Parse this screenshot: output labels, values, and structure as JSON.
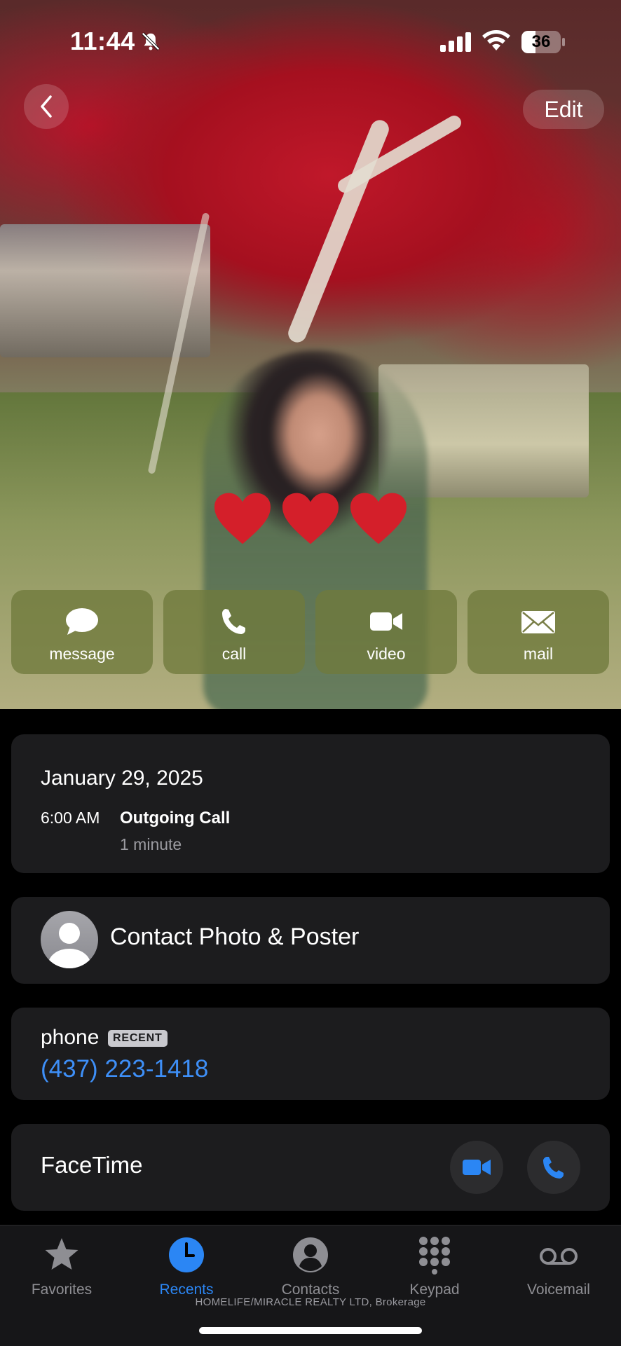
{
  "status_bar": {
    "time": "11:44",
    "battery": "36",
    "battery_level": 0.36
  },
  "nav": {
    "edit_label": "Edit"
  },
  "actions": [
    {
      "label": "message",
      "icon": "message-bubble-icon"
    },
    {
      "label": "call",
      "icon": "phone-icon"
    },
    {
      "label": "video",
      "icon": "video-camera-icon"
    },
    {
      "label": "mail",
      "icon": "envelope-icon"
    }
  ],
  "call_log": {
    "date": "January 29, 2025",
    "time": "6:00 AM",
    "type": "Outgoing Call",
    "duration": "1 minute"
  },
  "contact_poster": {
    "label": "Contact Photo & Poster"
  },
  "phone": {
    "label": "phone",
    "badge": "RECENT",
    "number": "(437) 223-1418"
  },
  "facetime": {
    "label": "FaceTime"
  },
  "tabs": [
    {
      "label": "Favorites",
      "icon": "star-icon",
      "active": false
    },
    {
      "label": "Recents",
      "icon": "clock-icon",
      "active": true
    },
    {
      "label": "Contacts",
      "icon": "person-circle-icon",
      "active": false
    },
    {
      "label": "Keypad",
      "icon": "keypad-icon",
      "active": false
    },
    {
      "label": "Voicemail",
      "icon": "voicemail-icon",
      "active": false
    }
  ],
  "footer_note": "HOMELIFE/MIRACLE REALTY LTD, Brokerage",
  "colors": {
    "link_blue": "#3e8ff7",
    "tab_active": "#2b86f4",
    "card_bg": "#1c1c1e",
    "heart_red": "#d41f2a"
  }
}
